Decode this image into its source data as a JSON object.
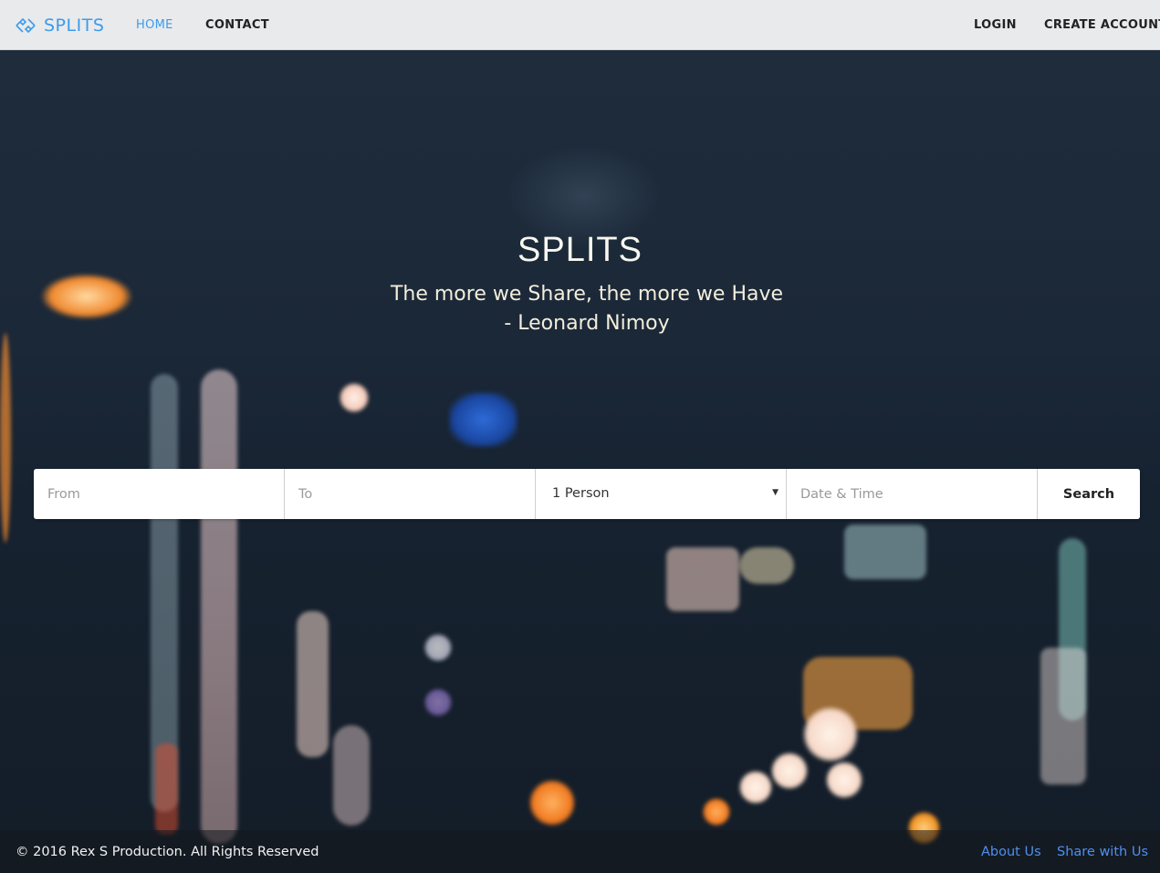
{
  "nav": {
    "brand": "SPLITS",
    "links": [
      "HOME",
      "CONTACT"
    ],
    "right_links": [
      "LOGIN",
      "CREATE ACCOUNT"
    ],
    "active": "HOME"
  },
  "hero": {
    "title": "SPLITS",
    "quote_line1": "The more we Share, the more we Have",
    "quote_line2": "- Leonard Nimoy"
  },
  "search": {
    "from_placeholder": "From",
    "to_placeholder": "To",
    "persons_selected": "1 Person",
    "datetime_placeholder": "Date & Time",
    "button_label": "Search"
  },
  "footer": {
    "copyright": "© 2016 Rex S Production. All Rights Reserved",
    "links": [
      "About Us",
      "Share with Us"
    ]
  },
  "colors": {
    "accent": "#3d9be9",
    "footer_link": "#4e8ff0",
    "navbar_bg": "#e9eaec"
  }
}
